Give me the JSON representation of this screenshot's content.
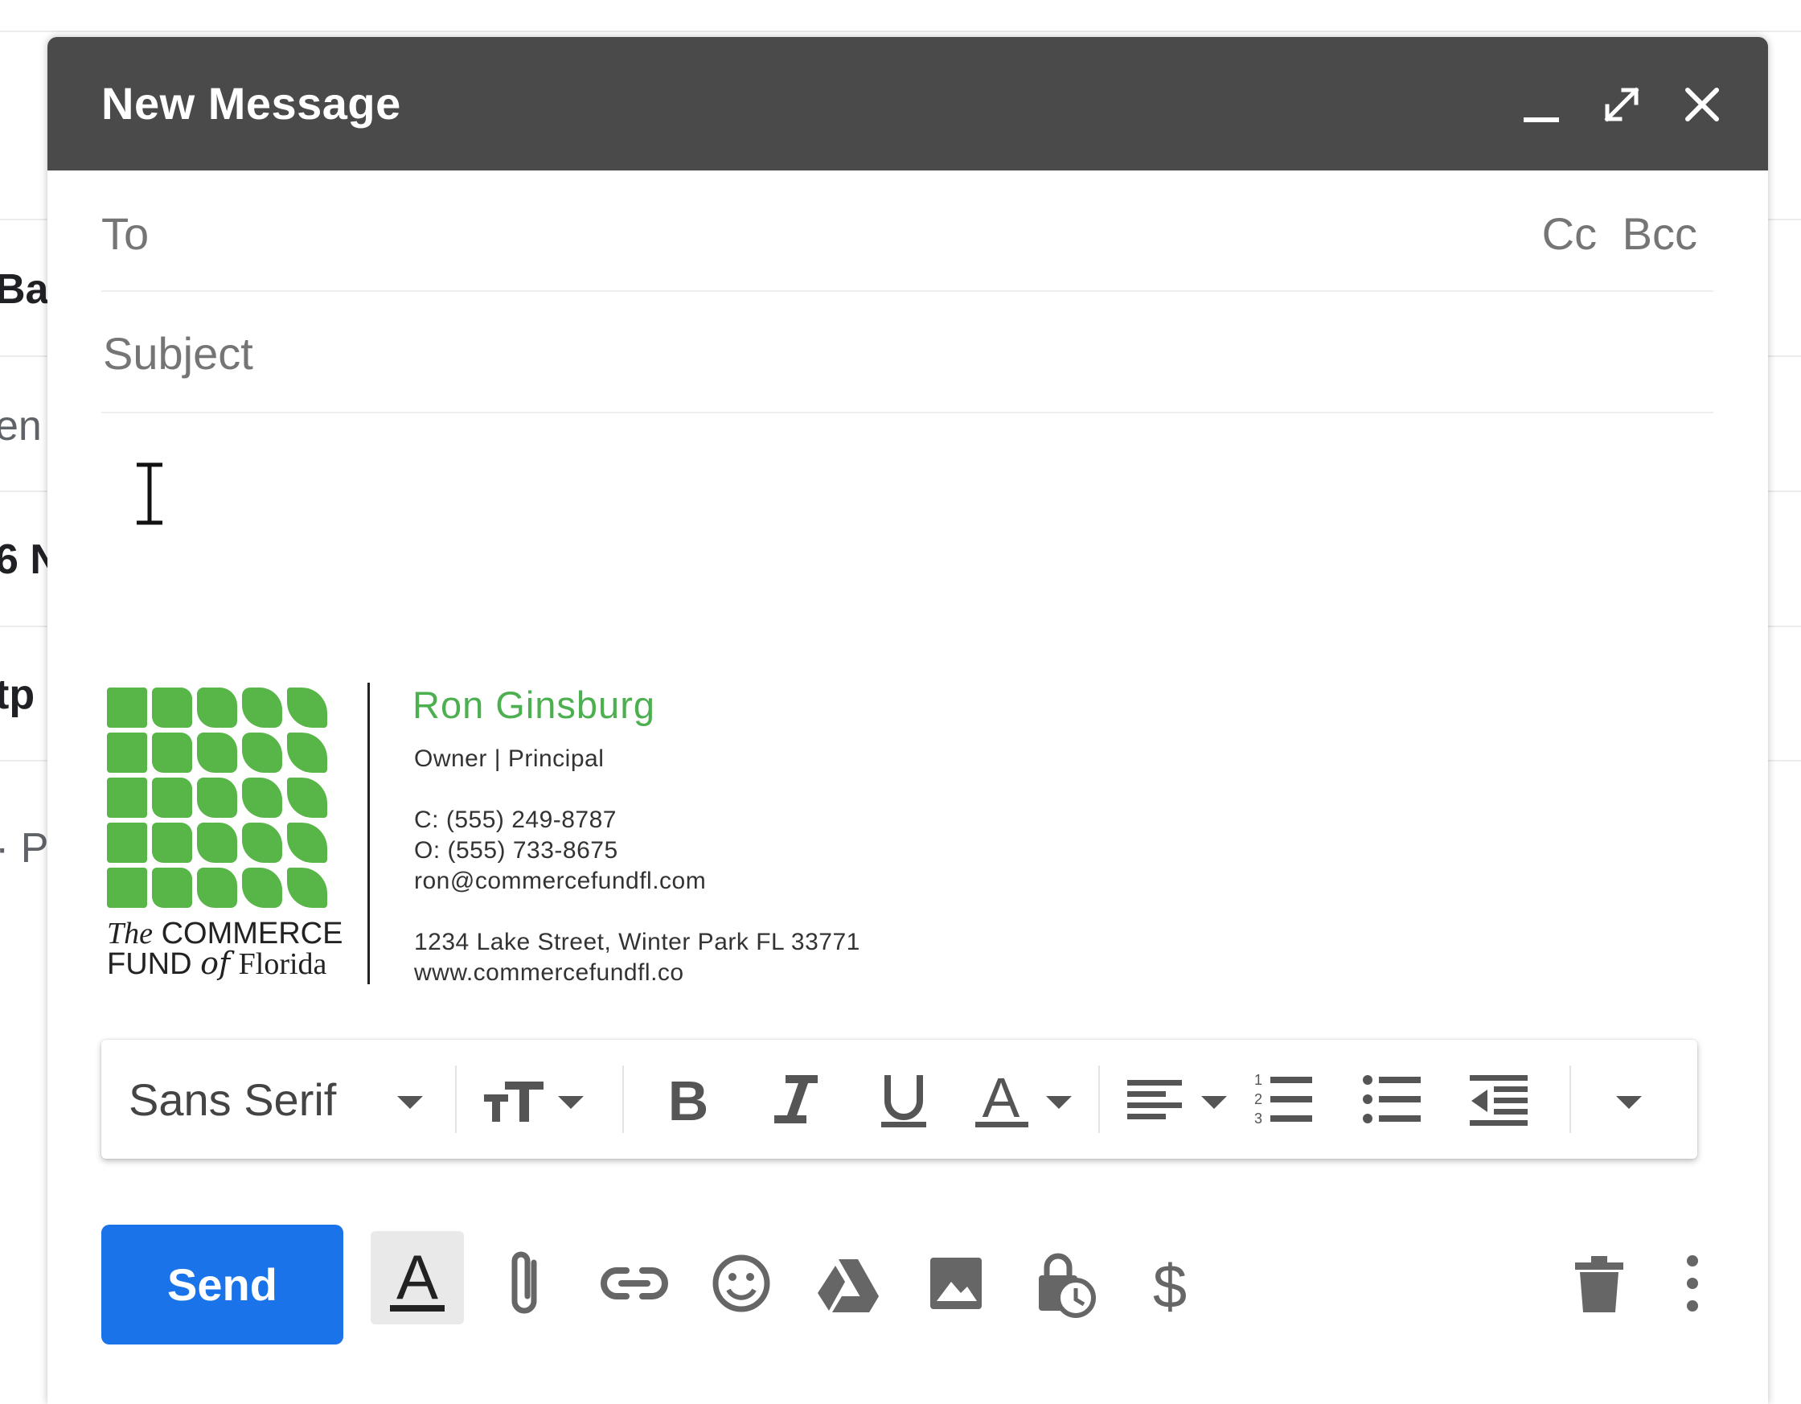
{
  "background": {
    "fragments": [
      "Ba",
      "en",
      "6 N",
      "tp",
      "· P"
    ]
  },
  "compose": {
    "title": "New Message",
    "to_label": "To",
    "cc_label": "Cc",
    "bcc_label": "Bcc",
    "subject_placeholder": "Subject"
  },
  "signature": {
    "logo_line1_prefix": "The",
    "logo_line1_main": "COMMERCE",
    "logo_line2_main": "FUND",
    "logo_line2_of": "of",
    "logo_line2_suffix": "Florida",
    "name": "Ron Ginsburg",
    "title": "Owner | Principal",
    "cell": "C: (555) 249-8787",
    "office": "O: (555) 733-8675",
    "email": "ron@commercefundfl.com",
    "address": "1234 Lake Street, Winter Park FL 33771",
    "website": "www.commercefundfl.co",
    "brand_color": "#58b548"
  },
  "toolbar": {
    "font": "Sans Serif"
  },
  "actions": {
    "send_label": "Send",
    "send_color": "#1a73e8"
  },
  "icons": [
    "minimize-icon",
    "expand-icon",
    "close-icon",
    "text-size-icon",
    "bold-icon",
    "italic-icon",
    "underline-icon",
    "text-color-icon",
    "align-icon",
    "numbered-list-icon",
    "bulleted-list-icon",
    "indent-less-icon",
    "more-formatting-icon",
    "formatting-options-icon",
    "attach-icon",
    "link-icon",
    "emoji-icon",
    "drive-icon",
    "photo-icon",
    "confidential-icon",
    "money-icon",
    "trash-icon",
    "more-options-icon"
  ]
}
